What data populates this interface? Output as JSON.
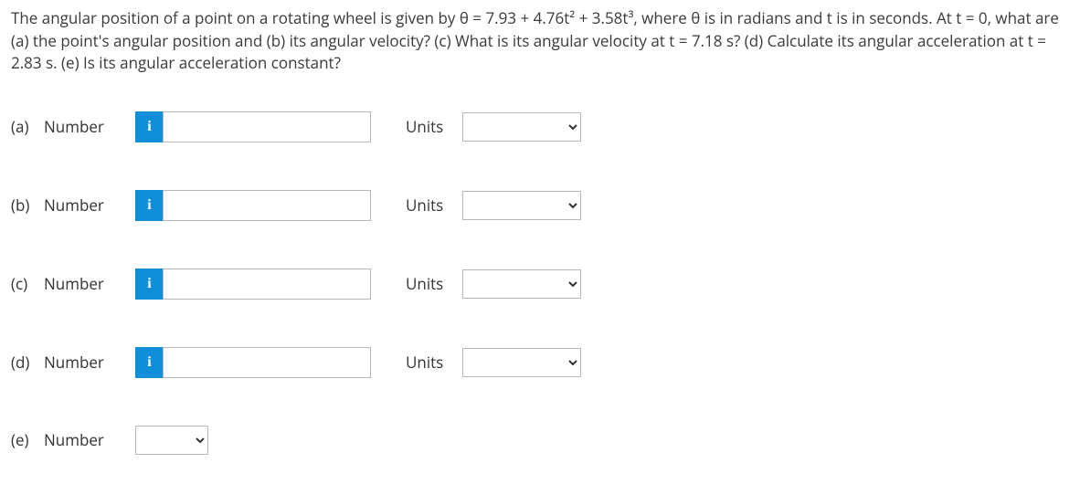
{
  "problem": {
    "full_text": "The angular position of a point on a rotating wheel is given by θ = 7.93 + 4.76t² + 3.58t³, where θ is in radians and t is in seconds. At t = 0, what are (a) the point's angular position and (b) its angular velocity? (c) What is its angular velocity at t = 7.18 s? (d) Calculate its angular acceleration at t = 2.83 s. (e) Is its angular acceleration constant?"
  },
  "labels": {
    "number": "Number",
    "units": "Units",
    "info_glyph": "i"
  },
  "parts": {
    "a": {
      "tag": "(a)"
    },
    "b": {
      "tag": "(b)"
    },
    "c": {
      "tag": "(c)"
    },
    "d": {
      "tag": "(d)"
    },
    "e": {
      "tag": "(e)"
    }
  }
}
